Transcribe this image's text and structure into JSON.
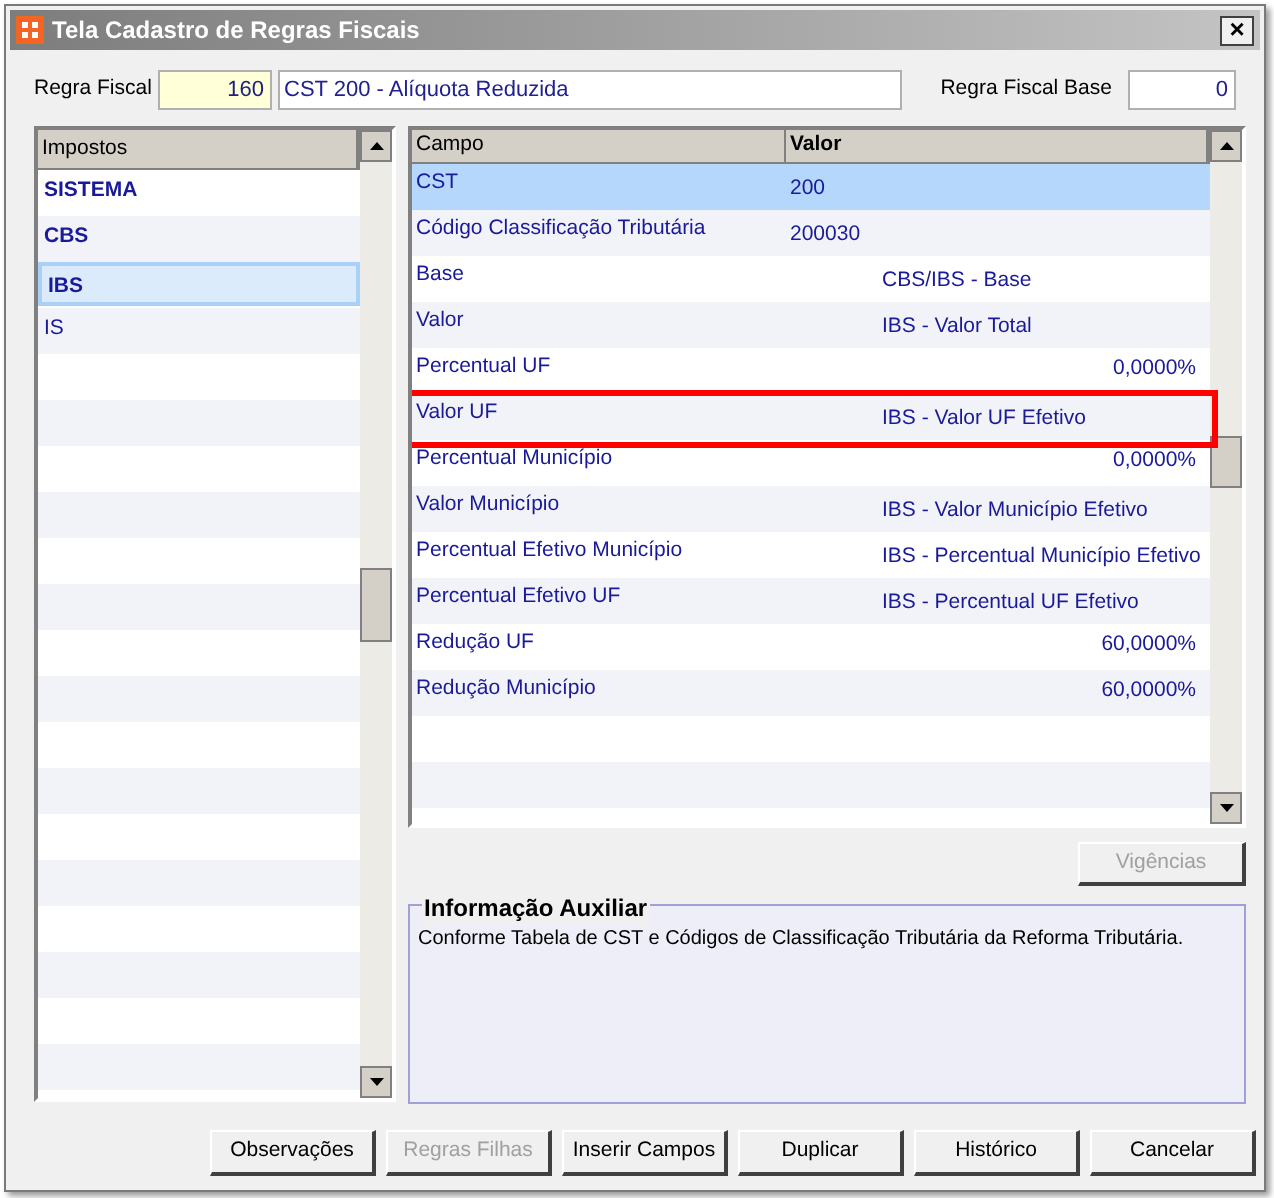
{
  "window": {
    "title": "Tela Cadastro de Regras Fiscais",
    "close": "×"
  },
  "header": {
    "regra_label": "Regra Fiscal",
    "regra_code": "160",
    "regra_name": "CST 200 - Alíquota Reduzida",
    "base_label": "Regra Fiscal Base",
    "base_value": "0"
  },
  "impostos": {
    "column": "Impostos",
    "items": [
      {
        "label": "SISTEMA",
        "bold": true,
        "selected": false
      },
      {
        "label": "CBS",
        "bold": true,
        "selected": false
      },
      {
        "label": "IBS",
        "bold": true,
        "selected": true
      },
      {
        "label": "IS",
        "bold": false,
        "selected": false
      }
    ]
  },
  "campos": {
    "columns": [
      "Campo",
      "Valor"
    ],
    "rows": [
      {
        "campo": "CST",
        "valor": "200",
        "kind": "code",
        "selected": true,
        "highlighted": false
      },
      {
        "campo": "Código Classificação Tributária",
        "valor": "200030",
        "kind": "code",
        "selected": false,
        "highlighted": false
      },
      {
        "campo": "Base",
        "valor": "CBS/IBS - Base",
        "kind": "reference",
        "selected": false,
        "highlighted": false
      },
      {
        "campo": "Valor",
        "valor": "IBS - Valor Total",
        "kind": "reference",
        "selected": false,
        "highlighted": false
      },
      {
        "campo": "Percentual UF",
        "valor": "0,0000%",
        "kind": "percent",
        "selected": false,
        "highlighted": false
      },
      {
        "campo": "Valor UF",
        "valor": "IBS - Valor UF Efetivo",
        "kind": "reference",
        "selected": false,
        "highlighted": true
      },
      {
        "campo": "Percentual Município",
        "valor": "0,0000%",
        "kind": "percent",
        "selected": false,
        "highlighted": false
      },
      {
        "campo": "Valor Município",
        "valor": "IBS - Valor Município Efetivo",
        "kind": "reference",
        "selected": false,
        "highlighted": false
      },
      {
        "campo": "Percentual Efetivo Município",
        "valor": "IBS - Percentual Município Efetivo",
        "kind": "reference",
        "selected": false,
        "highlighted": false
      },
      {
        "campo": "Percentual Efetivo UF",
        "valor": "IBS - Percentual UF Efetivo",
        "kind": "reference",
        "selected": false,
        "highlighted": false
      },
      {
        "campo": "Redução UF",
        "valor": "60,0000%",
        "kind": "percent",
        "selected": false,
        "highlighted": false
      },
      {
        "campo": "Redução Município",
        "valor": "60,0000%",
        "kind": "percent",
        "selected": false,
        "highlighted": false
      }
    ]
  },
  "vigencias_button": {
    "label": "Vigências",
    "disabled": true
  },
  "info": {
    "title": "Informação Auxiliar",
    "text": "Conforme Tabela de CST e Códigos de Classificação Tributária da Reforma Tributária."
  },
  "buttons": [
    {
      "label": "Observações",
      "disabled": false
    },
    {
      "label": "Regras Filhas",
      "disabled": true
    },
    {
      "label": "Inserir Campos",
      "disabled": false
    },
    {
      "label": "Duplicar",
      "disabled": false
    },
    {
      "label": "Histórico",
      "disabled": false
    },
    {
      "label": "Cancelar",
      "disabled": false
    }
  ]
}
